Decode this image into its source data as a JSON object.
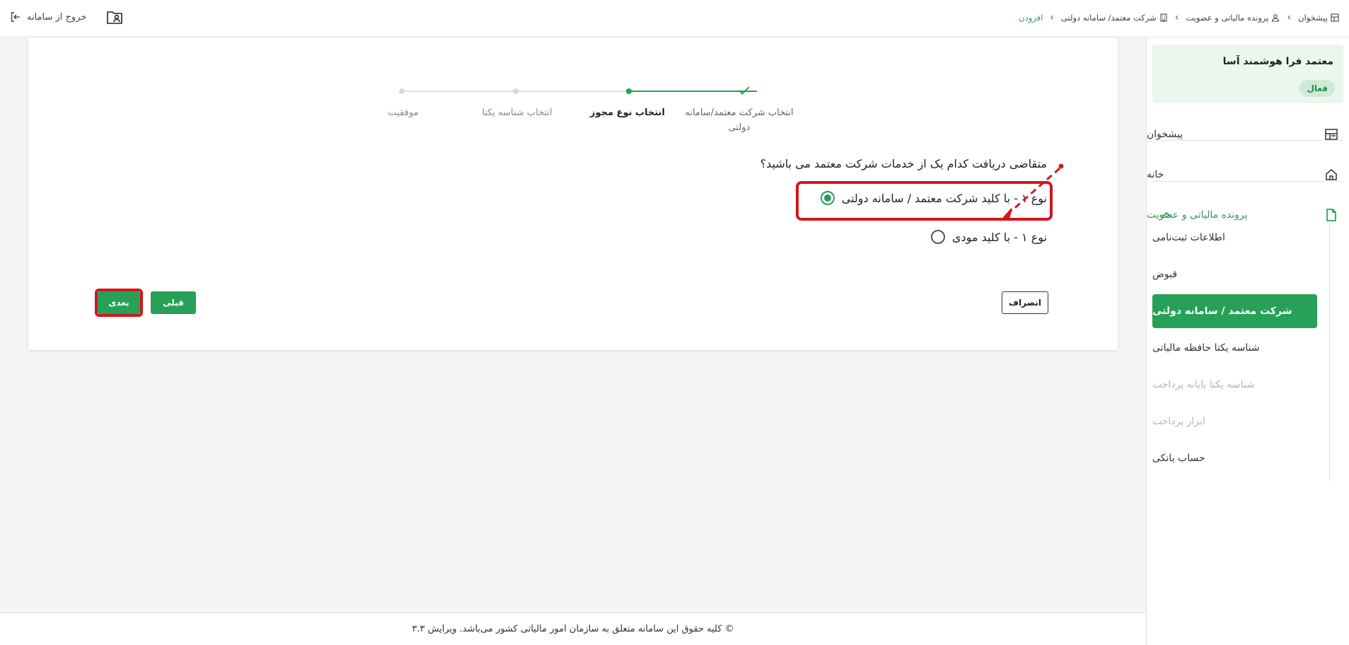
{
  "topbar": {
    "logout_label": "خروج از سامانه",
    "breadcrumb": [
      {
        "label": "پیشخوان",
        "icon": "dashboard-icon"
      },
      {
        "label": "پرونده مالیاتی و عضویت",
        "icon": "user-icon"
      },
      {
        "label": "شرکت معتمد/ سامانه دولتی",
        "icon": "building-icon"
      },
      {
        "label": "افزودن",
        "icon": ""
      }
    ]
  },
  "sidebar": {
    "company_name": "معتمد فرا هوشمند آسا",
    "status": "فعال",
    "items": [
      {
        "label": "پیشخوان",
        "icon": "dashboard-icon"
      },
      {
        "label": "خانه",
        "icon": "home-icon"
      },
      {
        "label": "پرونده مالیاتی و عضویت",
        "icon": "document-icon"
      }
    ],
    "subitems": [
      {
        "label": "اطلاعات ثبت‌نامی"
      },
      {
        "label": "قبوض"
      },
      {
        "label": "شرکت معتمد / سامانه دولتی"
      },
      {
        "label": "شناسه یکتا حافظه مالیاتی"
      },
      {
        "label": "شناسه یکتا پایانه پرداخت"
      },
      {
        "label": "ابزار پرداخت"
      },
      {
        "label": "حساب بانکی"
      }
    ]
  },
  "stepper": {
    "steps": [
      {
        "label": "انتخاب شرکت معتمد/سامانه دولتی",
        "state": "done"
      },
      {
        "label": "انتخاب نوع مجوز",
        "state": "current"
      },
      {
        "label": "انتخاب شناسه یکتا",
        "state": "pending"
      },
      {
        "label": "موفقیت",
        "state": "pending"
      }
    ]
  },
  "form": {
    "question": "متقاضی دریافت کدام یک از خدمات شرکت معتمد می باشید؟",
    "options": [
      {
        "label": "نوع ۱ - با کلید شرکت معتمد / سامانه دولتی",
        "checked": true
      },
      {
        "label": "نوع ۱ - با کلید مودی",
        "checked": false
      }
    ],
    "cancel_label": "انصراف",
    "prev_label": "قبلی",
    "next_label": "بعدی"
  },
  "footer": {
    "text": "© کلیه حقوق این سامانه متعلق به سازمان امور مالیاتی کشور می‌باشد. ویرایش ۳.۳"
  },
  "colors": {
    "accent": "#26a157",
    "highlight": "#d4151b"
  }
}
